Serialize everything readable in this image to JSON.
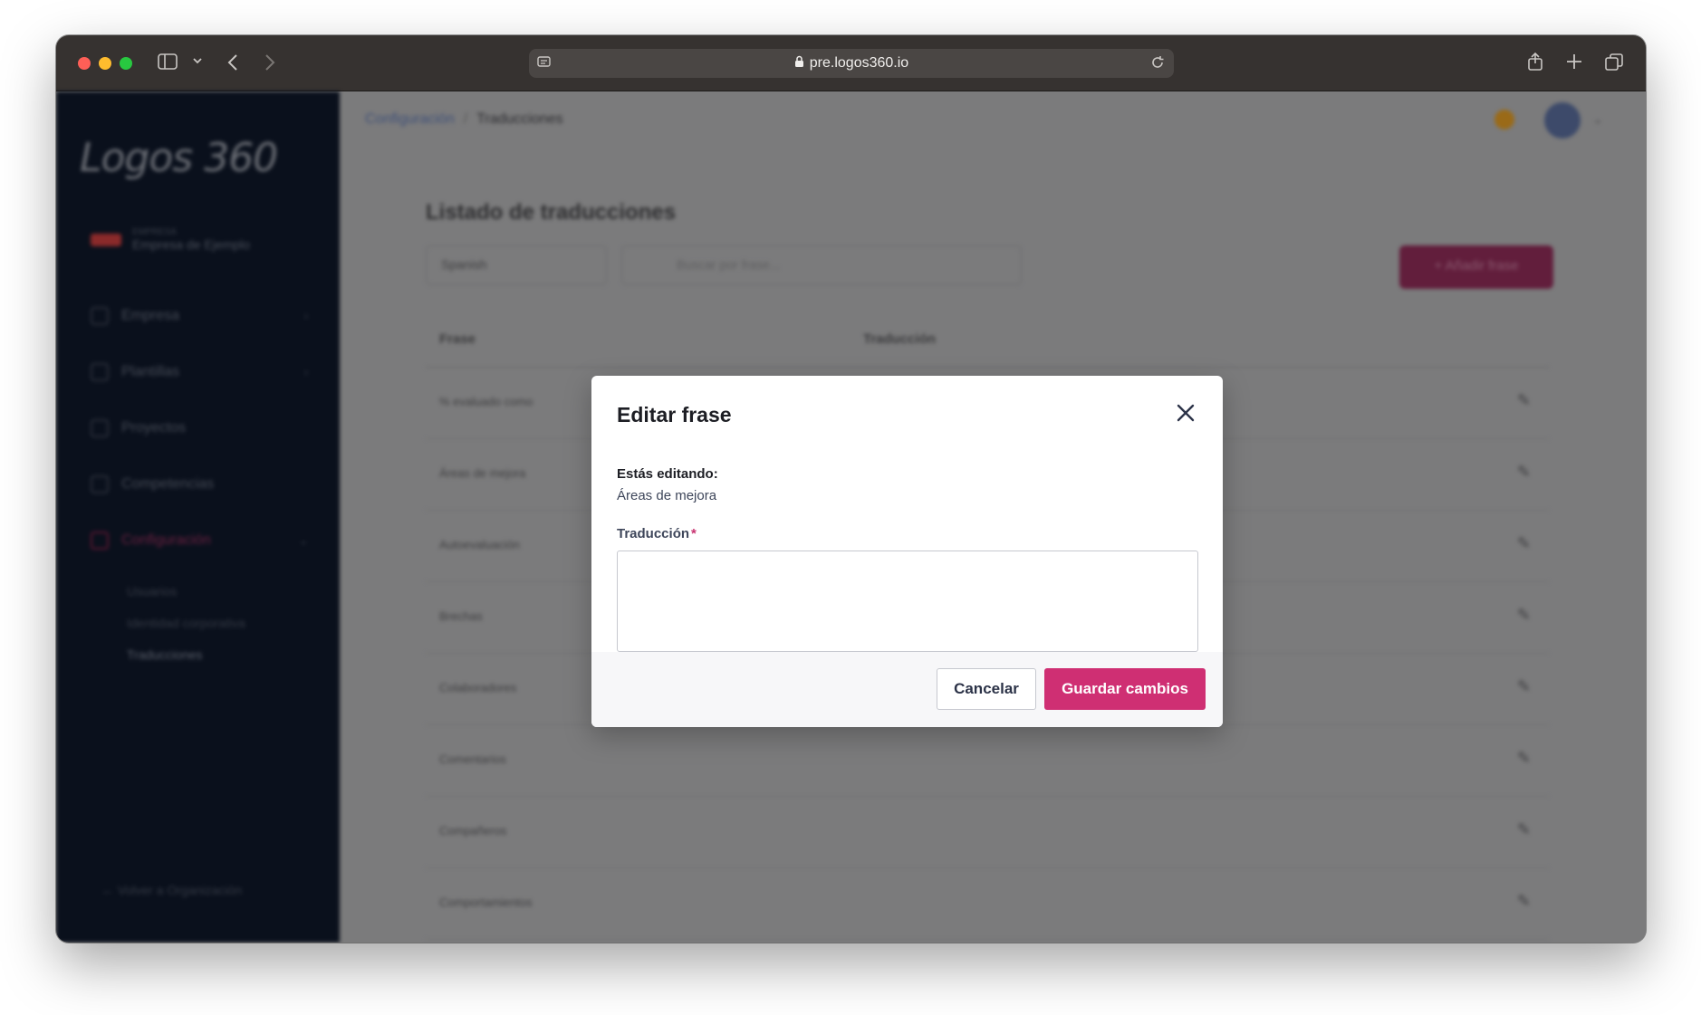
{
  "browser": {
    "url": "pre.logos360.io"
  },
  "sidebar": {
    "logo": "Logos 360",
    "company_small": "EMPRESA",
    "company_name": "Empresa de Ejemplo",
    "items": [
      {
        "label": "Empresa"
      },
      {
        "label": "Plantillas"
      },
      {
        "label": "Proyectos"
      },
      {
        "label": "Competencias"
      },
      {
        "label": "Configuración"
      }
    ],
    "sub_items": [
      {
        "label": "Usuarios"
      },
      {
        "label": "Identidad corporativa"
      },
      {
        "label": "Traducciones"
      }
    ],
    "back": "Volver a Organización"
  },
  "header": {
    "breadcrumb_parent": "Configuración",
    "breadcrumb_current": "Traducciones"
  },
  "list": {
    "title": "Listado de traducciones",
    "language": "Spanish",
    "search_placeholder": "Buscar por frase...",
    "add_button": "Añadir frase",
    "col_phrase": "Frase",
    "col_translation": "Traducción",
    "rows": [
      {
        "phrase": "% evaluado como"
      },
      {
        "phrase": "Áreas de mejora"
      },
      {
        "phrase": "Autoevaluación"
      },
      {
        "phrase": "Brechas"
      },
      {
        "phrase": "Colaboradores"
      },
      {
        "phrase": "Comentarios"
      },
      {
        "phrase": "Compañeros"
      },
      {
        "phrase": "Comportamientos"
      }
    ]
  },
  "modal": {
    "title": "Editar frase",
    "editing_label": "Estás editando:",
    "editing_value": "Áreas de mejora",
    "field_label": "Traducción",
    "required_mark": "*",
    "textarea_value": "",
    "cancel_label": "Cancelar",
    "save_label": "Guardar cambios"
  },
  "colors": {
    "accent": "#cf2f73",
    "sidebar_bg": "#0a101c",
    "overlay": "#7b7b7c"
  }
}
